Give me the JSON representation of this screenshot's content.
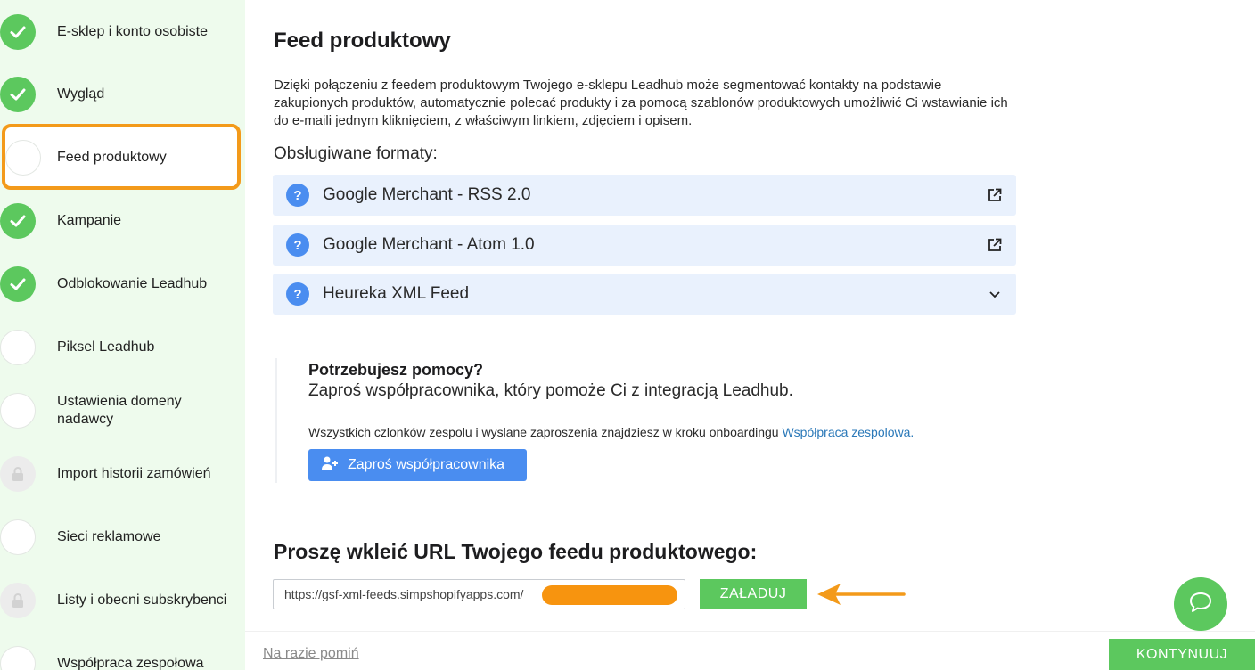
{
  "sidebar": {
    "items": [
      {
        "label": "E-sklep i konto osobiste",
        "status": "done"
      },
      {
        "label": "Wygląd",
        "status": "done"
      },
      {
        "label": "Feed produktowy",
        "status": "active"
      },
      {
        "label": "Kampanie",
        "status": "done"
      },
      {
        "label": "Odblokowanie Leadhub",
        "status": "done"
      },
      {
        "label": "Piksel Leadhub",
        "status": "todo"
      },
      {
        "label": "Ustawienia domeny nadawcy",
        "status": "todo"
      },
      {
        "label": "Import historii zamówień",
        "status": "locked"
      },
      {
        "label": "Sieci reklamowe",
        "status": "todo"
      },
      {
        "label": "Listy i obecni subskrybenci",
        "status": "locked"
      },
      {
        "label": "Współpraca zespołowa",
        "status": "todo"
      }
    ]
  },
  "main": {
    "title": "Feed produktowy",
    "description": "Dzięki połączeniu z feedem produktowym Twojego e-sklepu Leadhub może segmentować kontakty na podstawie zakupionych produktów, automatycznie polecać produkty i za pomocą szablonów produktowych umożliwić Ci wstawianie ich do e-maili jednym kliknięciem, z właściwym linkiem, zdjęciem i opisem.",
    "formats_heading": "Obsługiwane formaty:",
    "formats": [
      {
        "name": "Google Merchant - RSS 2.0",
        "action_icon": "external-link-icon"
      },
      {
        "name": "Google Merchant - Atom 1.0",
        "action_icon": "external-link-icon"
      },
      {
        "name": "Heureka XML Feed",
        "action_icon": "chevron-down-icon"
      }
    ],
    "help": {
      "title": "Potrzebujesz pomocy?",
      "subtitle": "Zaproś współpracownika, który pomoże Ci z integracją Leadhub.",
      "note": "Wszystkich czlonków zespolu i wyslane zaproszenia znajdziesz w kroku onboardingu ",
      "note_link": "Współpraca zespolowa.",
      "invite_label": "Zaproś współpracownika"
    },
    "url_heading": "Proszę wkleić URL Twojego feedu produktowego:",
    "url_value": "https://gsf-xml-feeds.simpshopifyapps.com/",
    "load_label": "ZAŁADUJ"
  },
  "footer": {
    "skip_label": "Na razie pomiń",
    "continue_label": "KONTYNUUJ"
  },
  "colors": {
    "accent_green": "#5cc85e",
    "accent_blue": "#4a8df0",
    "highlight_orange": "#f39a1a",
    "sidebar_bg": "#eefbed"
  }
}
